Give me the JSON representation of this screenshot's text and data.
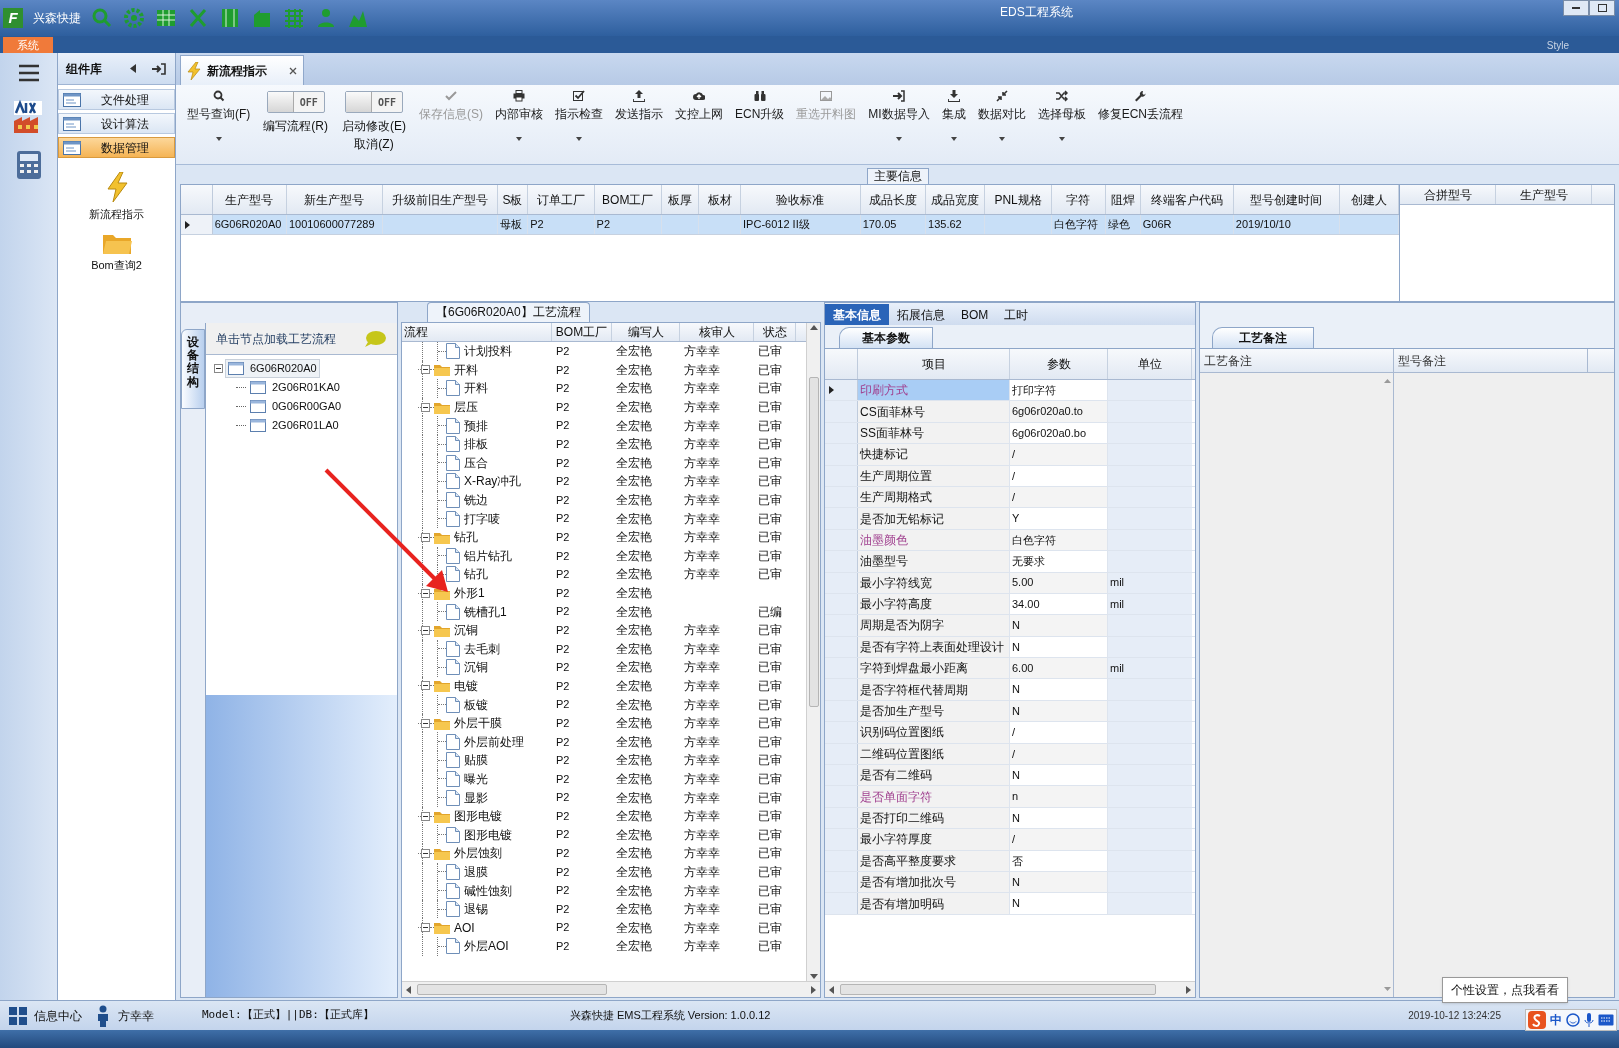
{
  "title_bar": {
    "logo": "F",
    "app_name": "兴森快捷",
    "title": "EDS工程系统"
  },
  "ribbon": {
    "tab": "系统",
    "style_label": "Style"
  },
  "component_panel": {
    "title": "组件库",
    "items": [
      {
        "label": "文件处理",
        "selected": false
      },
      {
        "label": "设计算法",
        "selected": false
      },
      {
        "label": "数据管理",
        "selected": true
      }
    ],
    "launchers": [
      {
        "label": "新流程指示",
        "kind": "bolt"
      },
      {
        "label": "Bom查询2",
        "kind": "folder"
      }
    ]
  },
  "document_tab": {
    "label": "新流程指示"
  },
  "toolbar": [
    {
      "kind": "button",
      "label": "型号查询(F)",
      "dropdown": true,
      "disabled": false
    },
    {
      "kind": "toggle",
      "label": "编写流程(R)",
      "switch_text": "OFF",
      "on": false
    },
    {
      "kind": "toggle",
      "label": "启动修改(E)",
      "sublabel": "取消(Z)",
      "switch_text": "OFF",
      "on": false
    },
    {
      "kind": "button",
      "label": "保存信息(S)",
      "dropdown": false,
      "disabled": true
    },
    {
      "kind": "button",
      "label": "内部审核",
      "dropdown": true,
      "disabled": false
    },
    {
      "kind": "button",
      "label": "指示检查",
      "dropdown": true,
      "disabled": false
    },
    {
      "kind": "button",
      "label": "发送指示",
      "dropdown": false,
      "disabled": false
    },
    {
      "kind": "button",
      "label": "文控上网",
      "dropdown": false,
      "disabled": false
    },
    {
      "kind": "button",
      "label": "ECN升级",
      "dropdown": false,
      "disabled": false
    },
    {
      "kind": "button",
      "label": "重选开料图",
      "dropdown": false,
      "disabled": true
    },
    {
      "kind": "button",
      "label": "MI数据导入",
      "dropdown": true,
      "disabled": false
    },
    {
      "kind": "button",
      "label": "集成",
      "dropdown": true,
      "disabled": false
    },
    {
      "kind": "button",
      "label": "数据对比",
      "dropdown": true,
      "disabled": false
    },
    {
      "kind": "button",
      "label": "选择母板",
      "dropdown": true,
      "disabled": false
    },
    {
      "kind": "button",
      "label": "修复ECN丢流程",
      "dropdown": false,
      "disabled": false
    }
  ],
  "main_info": {
    "title": "主要信息",
    "columns": [
      "生产型号",
      "新生产型号",
      "升级前旧生产型号",
      "S板",
      "订单工厂",
      "BOM工厂",
      "板厚",
      "板材",
      "验收标准",
      "成品长度",
      "成品宽度",
      "PNL规格",
      "字符",
      "阻焊",
      "终端客户代码",
      "型号创建时间",
      "创建人"
    ],
    "rows": [
      {
        "selected": true,
        "cells": [
          "6G06R020A0",
          "10010600077289",
          null,
          "母板",
          "P2",
          "P2",
          null,
          null,
          "IPC-6012 II级",
          "170.05",
          "135.62",
          null,
          "白色字符",
          "绿色",
          "G06R",
          "2019/10/10",
          null
        ]
      }
    ],
    "side_columns": [
      "合拼型号",
      "生产型号"
    ]
  },
  "structure_panel": {
    "vertical_tab": "设备结构",
    "header": "单击节点加载工艺流程",
    "tree": [
      {
        "label": "6G06R020A0",
        "expanded": true,
        "children": [
          {
            "label": "2G06R01KA0"
          },
          {
            "label": "0G06R00GA0"
          },
          {
            "label": "2G06R01LA0"
          }
        ]
      }
    ]
  },
  "flow_panel": {
    "title": "【6G06R020A0】工艺流程",
    "columns": [
      "流程",
      "BOM工厂",
      "编写人",
      "核审人",
      "状态"
    ],
    "flow": [
      {
        "children": [
          {
            "name": "计划投料",
            "bom": "P2",
            "writer": "全宏艳",
            "reviewer": "方幸幸",
            "status": "已审"
          }
        ]
      },
      {
        "name": "开料",
        "bom": "P2",
        "writer": "全宏艳",
        "reviewer": "方幸幸",
        "status": "已审",
        "expanded": true,
        "children": [
          {
            "name": "开料",
            "bom": "P2",
            "writer": "全宏艳",
            "reviewer": "方幸幸",
            "status": "已审"
          }
        ]
      },
      {
        "name": "层压",
        "bom": "P2",
        "writer": "全宏艳",
        "reviewer": "方幸幸",
        "status": "已审",
        "expanded": true,
        "children": [
          {
            "name": "预排",
            "bom": "P2",
            "writer": "全宏艳",
            "reviewer": "方幸幸",
            "status": "已审"
          },
          {
            "name": "排板",
            "bom": "P2",
            "writer": "全宏艳",
            "reviewer": "方幸幸",
            "status": "已审"
          },
          {
            "name": "压合",
            "bom": "P2",
            "writer": "全宏艳",
            "reviewer": "方幸幸",
            "status": "已审"
          },
          {
            "name": "X-Ray冲孔",
            "bom": "P2",
            "writer": "全宏艳",
            "reviewer": "方幸幸",
            "status": "已审"
          },
          {
            "name": "铣边",
            "bom": "P2",
            "writer": "全宏艳",
            "reviewer": "方幸幸",
            "status": "已审"
          },
          {
            "name": "打字唛",
            "bom": "P2",
            "writer": "全宏艳",
            "reviewer": "方幸幸",
            "status": "已审"
          }
        ]
      },
      {
        "name": "钻孔",
        "bom": "P2",
        "writer": "全宏艳",
        "reviewer": "方幸幸",
        "status": "已审",
        "expanded": true,
        "children": [
          {
            "name": "铝片钻孔",
            "bom": "P2",
            "writer": "全宏艳",
            "reviewer": "方幸幸",
            "status": "已审"
          },
          {
            "name": "钻孔",
            "bom": "P2",
            "writer": "全宏艳",
            "reviewer": "方幸幸",
            "status": "已审"
          }
        ]
      },
      {
        "name": "外形1",
        "bom": "P2",
        "writer": "全宏艳",
        "expanded": true,
        "children": [
          {
            "name": "铣槽孔1",
            "bom": "P2",
            "writer": "全宏艳",
            "status": "已编"
          }
        ]
      },
      {
        "name": "沉铜",
        "bom": "P2",
        "writer": "全宏艳",
        "reviewer": "方幸幸",
        "status": "已审",
        "expanded": true,
        "children": [
          {
            "name": "去毛刺",
            "bom": "P2",
            "writer": "全宏艳",
            "reviewer": "方幸幸",
            "status": "已审"
          },
          {
            "name": "沉铜",
            "bom": "P2",
            "writer": "全宏艳",
            "reviewer": "方幸幸",
            "status": "已审"
          }
        ]
      },
      {
        "name": "电镀",
        "bom": "P2",
        "writer": "全宏艳",
        "reviewer": "方幸幸",
        "status": "已审",
        "expanded": true,
        "children": [
          {
            "name": "板镀",
            "bom": "P2",
            "writer": "全宏艳",
            "reviewer": "方幸幸",
            "status": "已审"
          }
        ]
      },
      {
        "name": "外层干膜",
        "bom": "P2",
        "writer": "全宏艳",
        "reviewer": "方幸幸",
        "status": "已审",
        "expanded": true,
        "children": [
          {
            "name": "外层前处理",
            "bom": "P2",
            "writer": "全宏艳",
            "reviewer": "方幸幸",
            "status": "已审"
          },
          {
            "name": "贴膜",
            "bom": "P2",
            "writer": "全宏艳",
            "reviewer": "方幸幸",
            "status": "已审"
          },
          {
            "name": "曝光",
            "bom": "P2",
            "writer": "全宏艳",
            "reviewer": "方幸幸",
            "status": "已审"
          },
          {
            "name": "显影",
            "bom": "P2",
            "writer": "全宏艳",
            "reviewer": "方幸幸",
            "status": "已审"
          }
        ]
      },
      {
        "name": "图形电镀",
        "bom": "P2",
        "writer": "全宏艳",
        "reviewer": "方幸幸",
        "status": "已审",
        "expanded": true,
        "children": [
          {
            "name": "图形电镀",
            "bom": "P2",
            "writer": "全宏艳",
            "reviewer": "方幸幸",
            "status": "已审"
          }
        ]
      },
      {
        "name": "外层蚀刻",
        "bom": "P2",
        "writer": "全宏艳",
        "reviewer": "方幸幸",
        "status": "已审",
        "expanded": true,
        "children": [
          {
            "name": "退膜",
            "bom": "P2",
            "writer": "全宏艳",
            "reviewer": "方幸幸",
            "status": "已审"
          },
          {
            "name": "碱性蚀刻",
            "bom": "P2",
            "writer": "全宏艳",
            "reviewer": "方幸幸",
            "status": "已审"
          },
          {
            "name": "退锡",
            "bom": "P2",
            "writer": "全宏艳",
            "reviewer": "方幸幸",
            "status": "已审"
          }
        ]
      },
      {
        "name": "AOI",
        "bom": "P2",
        "writer": "全宏艳",
        "reviewer": "方幸幸",
        "status": "已审",
        "expanded": true,
        "children": [
          {
            "name": "外层AOI",
            "bom": "P2",
            "writer": "全宏艳",
            "reviewer": "方幸幸",
            "status": "已审"
          }
        ]
      }
    ]
  },
  "detail_panel": {
    "tabs": [
      {
        "label": "基本信息",
        "selected": true
      },
      {
        "label": "拓展信息",
        "selected": false
      },
      {
        "label": "BOM",
        "selected": false
      },
      {
        "label": "工时",
        "selected": false
      }
    ],
    "subtab": "基本参数",
    "columns": [
      "项目",
      "参数",
      "单位"
    ],
    "rows": [
      {
        "item": "印刷方式",
        "value": "打印字符",
        "flagged": true,
        "selected": true
      },
      {
        "item": "CS面菲林号",
        "value": "6g06r020a0.to",
        "flagged": false,
        "selected": false
      },
      {
        "item": "SS面菲林号",
        "value": "6g06r020a0.bo",
        "flagged": false,
        "selected": false
      },
      {
        "item": "快捷标记",
        "value": "/",
        "flagged": false,
        "selected": false
      },
      {
        "item": "生产周期位置",
        "value": "/",
        "flagged": false,
        "selected": false
      },
      {
        "item": "生产周期格式",
        "value": "/",
        "flagged": false,
        "selected": false
      },
      {
        "item": "是否加无铅标记",
        "value": "Y",
        "flagged": false,
        "selected": false
      },
      {
        "item": "油墨颜色",
        "value": "白色字符",
        "flagged": true,
        "selected": false
      },
      {
        "item": "油墨型号",
        "value": "无要求",
        "flagged": false,
        "selected": false
      },
      {
        "item": "最小字符线宽",
        "value": "5.00",
        "unit": "mil",
        "flagged": false,
        "selected": false
      },
      {
        "item": "最小字符高度",
        "value": "34.00",
        "unit": "mil",
        "flagged": false,
        "selected": false
      },
      {
        "item": "周期是否为阴字",
        "value": "N",
        "flagged": false,
        "selected": false
      },
      {
        "item": "是否有字符上表面处理设计",
        "value": "N",
        "flagged": false,
        "selected": false
      },
      {
        "item": "字符到焊盘最小距离",
        "value": "6.00",
        "unit": "mil",
        "flagged": false,
        "selected": false
      },
      {
        "item": "是否字符框代替周期",
        "value": "N",
        "flagged": false,
        "selected": false
      },
      {
        "item": "是否加生产型号",
        "value": "N",
        "flagged": false,
        "selected": false
      },
      {
        "item": "识别码位置图纸",
        "value": "/",
        "flagged": false,
        "selected": false
      },
      {
        "item": "二维码位置图纸",
        "value": "/",
        "flagged": false,
        "selected": false
      },
      {
        "item": "是否有二维码",
        "value": "N",
        "flagged": false,
        "selected": false
      },
      {
        "item": "是否单面字符",
        "value": "n",
        "flagged": true,
        "selected": false
      },
      {
        "item": "是否打印二维码",
        "value": "N",
        "flagged": false,
        "selected": false
      },
      {
        "item": "最小字符厚度",
        "value": "/",
        "flagged": false,
        "selected": false
      },
      {
        "item": "是否高平整度要求",
        "value": "否",
        "flagged": false,
        "selected": false
      },
      {
        "item": "是否有增加批次号",
        "value": "N",
        "flagged": false,
        "selected": false
      },
      {
        "item": "是否有增加明码",
        "value": "N",
        "flagged": false,
        "selected": false
      }
    ]
  },
  "notes_panel": {
    "tab": "工艺备注",
    "columns": [
      "工艺备注",
      "型号备注"
    ],
    "tooltip": "个性设置，点我看看"
  },
  "status_bar": {
    "message_center": "信息中心",
    "user": "方幸幸",
    "environment": "Model:【正式】||DB:【正式库】",
    "version": "兴森快捷 EMS工程系统 Version: 1.0.0.12",
    "clock": "2019-10-12 13:24:25",
    "ime": "中"
  }
}
